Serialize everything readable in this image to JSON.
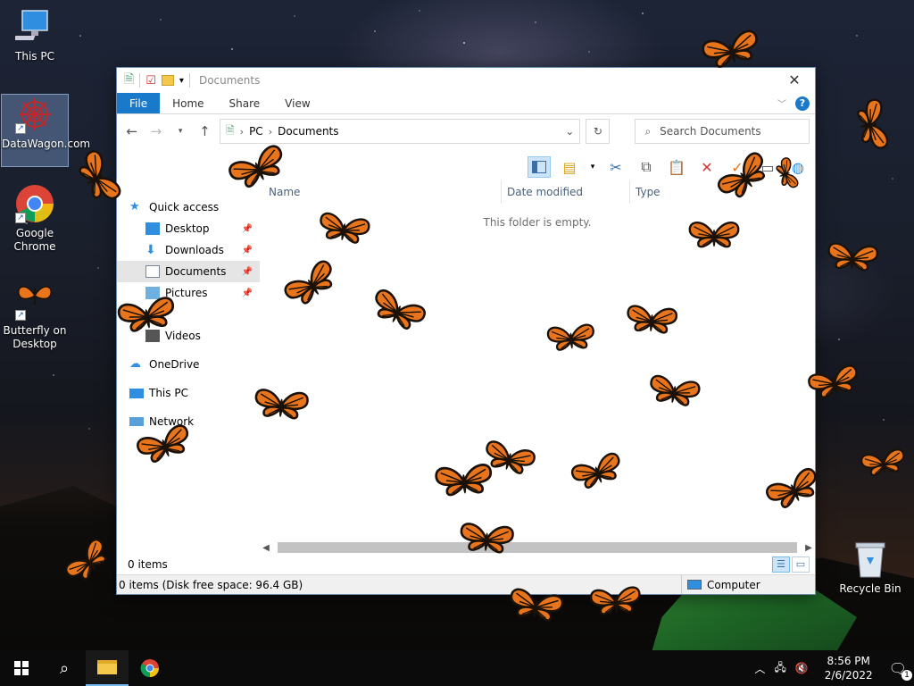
{
  "desktop": {
    "icons": [
      {
        "label": "This PC"
      },
      {
        "label": "DataWagon.com"
      },
      {
        "label": "Google Chrome"
      },
      {
        "label": "Butterfly on Desktop"
      }
    ],
    "recycle_bin_label": "Recycle Bin"
  },
  "window": {
    "title": "Documents",
    "tabs": {
      "file": "File",
      "home": "Home",
      "share": "Share",
      "view": "View"
    },
    "address": {
      "crumb_parent": "PC",
      "crumb_current": "Documents"
    },
    "search_placeholder": "Search Documents",
    "nav": {
      "quick_access": "Quick access",
      "desktop": "Desktop",
      "downloads": "Downloads",
      "documents": "Documents",
      "pictures": "Pictures",
      "videos": "Videos",
      "onedrive": "OneDrive",
      "this_pc": "This PC",
      "network": "Network"
    },
    "columns": {
      "name": "Name",
      "date_modified": "Date modified",
      "type": "Type"
    },
    "empty_message": "This folder is empty.",
    "item_count": "0 items",
    "status_detail": "0 items (Disk free space: 96.4 GB)",
    "status_location": "Computer"
  },
  "taskbar": {
    "time": "8:56 PM",
    "date": "2/6/2022",
    "notification_count": "1"
  },
  "colors": {
    "accent": "#1979ca",
    "butterfly_orange": "#e8741c",
    "butterfly_dark": "#1a1108"
  }
}
